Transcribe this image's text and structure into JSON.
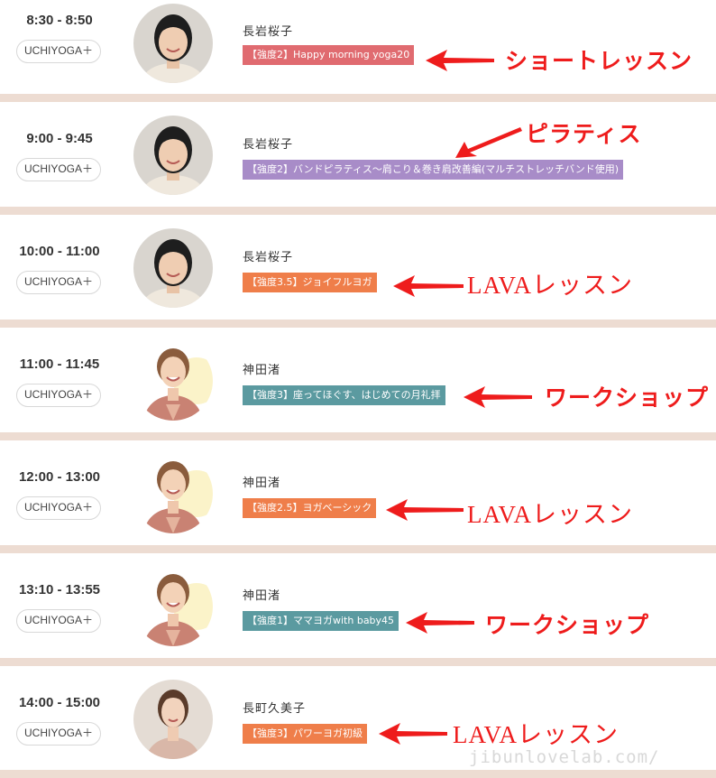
{
  "colors": {
    "separator": "#eddcd2",
    "note_red": "#ee1c1c",
    "badge_pink": "#e06b70",
    "badge_purple": "#a88cc8",
    "badge_orange": "#ef7e4a",
    "badge_teal": "#5b9aa0"
  },
  "schedule": [
    {
      "time": "8:30 - 8:50",
      "program": "UCHIYOGA＋",
      "instructor": "長岩桜子",
      "lesson": "【強度2】Happy morning yoga20",
      "badge_color": "#e06b70",
      "note": "ショートレッスン",
      "avatar_icon": "instructor-a-photo"
    },
    {
      "time": "9:00 - 9:45",
      "program": "UCHIYOGA＋",
      "instructor": "長岩桜子",
      "lesson": "【強度2】バンドピラティス〜肩こり＆巻き肩改善編(マルチストレッチバンド使用)",
      "badge_color": "#a88cc8",
      "note": "ピラティス",
      "avatar_icon": "instructor-a-photo"
    },
    {
      "time": "10:00 - 11:00",
      "program": "UCHIYOGA＋",
      "instructor": "長岩桜子",
      "lesson": "【強度3.5】ジョイフルヨガ",
      "badge_color": "#ef7e4a",
      "note": "LAVAレッスン",
      "avatar_icon": "instructor-a-photo"
    },
    {
      "time": "11:00 - 11:45",
      "program": "UCHIYOGA＋",
      "instructor": "神田渚",
      "lesson": "【強度3】座ってほぐす、はじめての月礼拝",
      "badge_color": "#5b9aa0",
      "note": "ワークショップ",
      "avatar_icon": "instructor-b-photo"
    },
    {
      "time": "12:00 - 13:00",
      "program": "UCHIYOGA＋",
      "instructor": "神田渚",
      "lesson": "【強度2.5】ヨガベーシック",
      "badge_color": "#ef7e4a",
      "note": "LAVAレッスン",
      "avatar_icon": "instructor-b-photo"
    },
    {
      "time": "13:10 - 13:55",
      "program": "UCHIYOGA＋",
      "instructor": "神田渚",
      "lesson": "【強度1】ママヨガwith baby45",
      "badge_color": "#5b9aa0",
      "note": "ワークショップ",
      "avatar_icon": "instructor-b-photo"
    },
    {
      "time": "14:00 - 15:00",
      "program": "UCHIYOGA＋",
      "instructor": "長町久美子",
      "lesson": "【強度3】パワーヨガ初級",
      "badge_color": "#ef7e4a",
      "note": "LAVAレッスン",
      "avatar_icon": "instructor-c-photo"
    }
  ],
  "watermark": "jibunlovelab.com/"
}
